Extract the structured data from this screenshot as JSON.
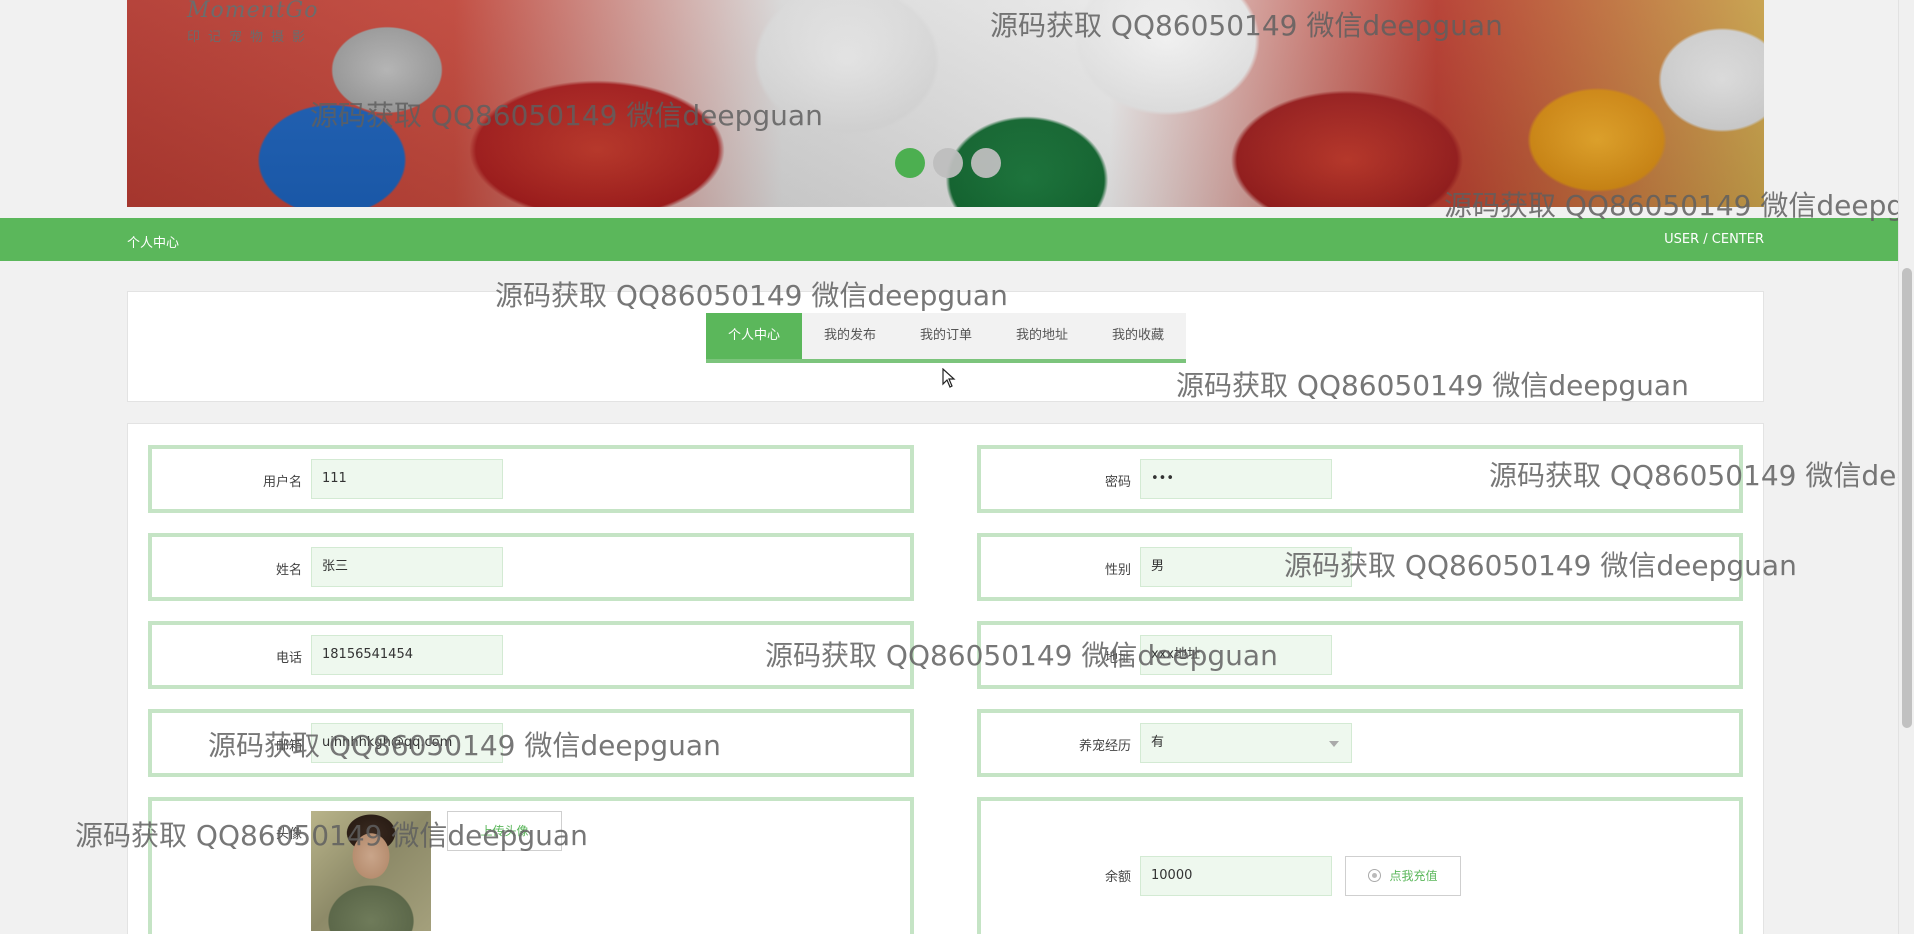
{
  "banner": {
    "brand": "MomentGo",
    "brand_sub": "印记宠物摄影",
    "dots": [
      {
        "active": true
      },
      {
        "active": false
      },
      {
        "active": false
      }
    ]
  },
  "nav": {
    "title": "个人中心",
    "subtitle": "USER / CENTER"
  },
  "tabs": [
    {
      "label": "个人中心",
      "active": true
    },
    {
      "label": "我的发布",
      "active": false
    },
    {
      "label": "我的订单",
      "active": false
    },
    {
      "label": "我的地址",
      "active": false
    },
    {
      "label": "我的收藏",
      "active": false
    }
  ],
  "form": {
    "username": {
      "label": "用户名",
      "value": "111"
    },
    "password": {
      "label": "密码",
      "value": "•••"
    },
    "name": {
      "label": "姓名",
      "value": "张三"
    },
    "gender": {
      "label": "性别",
      "value": "男"
    },
    "phone": {
      "label": "电话",
      "value": "18156541454"
    },
    "address": {
      "label": "地址",
      "value": "xxx地址"
    },
    "email": {
      "label": "邮箱",
      "value": "uihhhhkgh@qq.com"
    },
    "pet_experience": {
      "label": "养宠经历",
      "value": "有"
    },
    "avatar": {
      "label": "头像",
      "upload_label": "上传头像"
    },
    "balance": {
      "label": "余额",
      "value": "10000",
      "recharge_label": "点我充值"
    }
  },
  "watermark": "源码获取 QQ86050149 微信deepguan",
  "colors": {
    "accent": "#5bb75b",
    "field_border": "#c5e4c5",
    "input_bg": "#eef8ee"
  }
}
